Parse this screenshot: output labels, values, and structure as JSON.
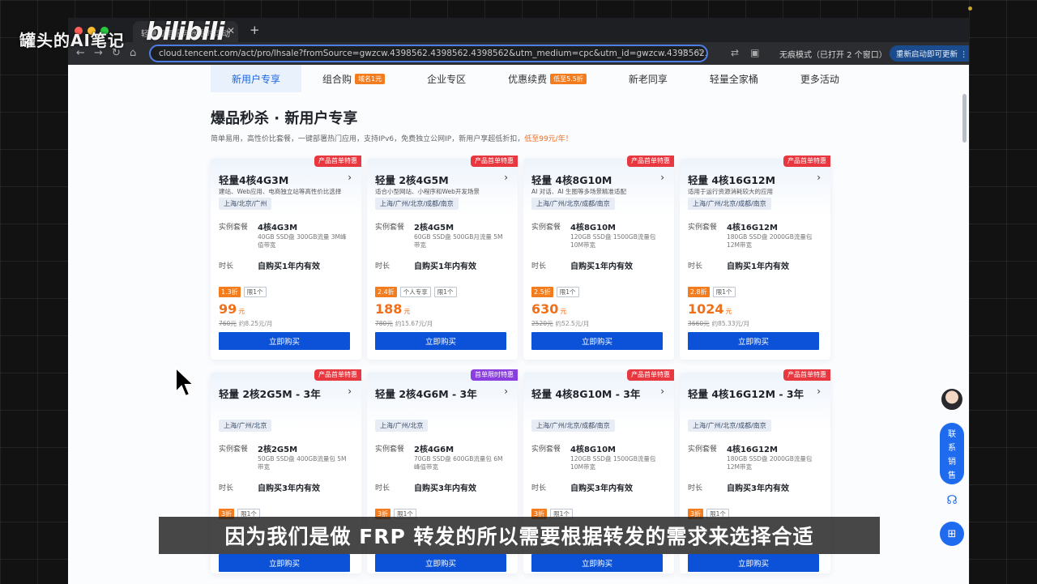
{
  "watermark": {
    "text": "罐头的AI笔记",
    "logo": "bilibili"
  },
  "browser": {
    "tab_title": "轻量应用服务器限时活动",
    "url": "cloud.tencent.com/act/pro/lhsale?fromSource=gwzcw.4398562.4398562.4398562&utm_medium=cpc&utm_id=gwzcw.4398562.4398562.439856",
    "incognito_label": "无痕模式（已打开 2 个窗口）",
    "update_label": "重新启动即可更新 ⋮"
  },
  "nav": {
    "items": [
      {
        "label": "新用户专享",
        "badge": ""
      },
      {
        "label": "组合购",
        "badge": "域名1元"
      },
      {
        "label": "企业专区",
        "badge": ""
      },
      {
        "label": "优惠续费",
        "badge": "低至5.5折"
      },
      {
        "label": "新老同享",
        "badge": ""
      },
      {
        "label": "轻量全家桶",
        "badge": ""
      },
      {
        "label": "更多活动",
        "badge": ""
      }
    ]
  },
  "hero": {
    "title": "爆品秒杀 · 新用户专享",
    "subtitle": "简单易用，高性价比套餐，一键部署热门应用，支持IPv6，免费独立公网IP，新用户享超低折扣，",
    "highlight": "低至99元/年！"
  },
  "labels": {
    "spec": "实例套餐",
    "duration": "时长",
    "buy": "立即购买"
  },
  "cards": [
    {
      "ribbon": "产品首单特惠",
      "title": "轻量4核4G3M",
      "desc": "建站、Web应用、电商独立站等高性价比选择",
      "region": "上海/北京/广州",
      "spec": "4核4G3M",
      "spec_desc": "40GB SSD盘 300GB流量 3M峰值带宽",
      "duration": "自购买1年内有效",
      "discount": "1.3折",
      "tags": [
        "限1个"
      ],
      "price": "99",
      "unit": "元",
      "orig_price": "760元",
      "monthly": "约8.25元/月"
    },
    {
      "ribbon": "产品首单特惠",
      "title": "轻量 2核4G5M",
      "desc": "适合小型网站、小程序和Web开发场景",
      "region": "上海/广州/北京/成都/南京",
      "spec": "2核4G5M",
      "spec_desc": "60GB SSD盘 500GB月流量 5M带宽",
      "duration": "自购买1年内有效",
      "discount": "2.4折",
      "tags": [
        "个人专享",
        "限1个"
      ],
      "price": "188",
      "unit": "元",
      "orig_price": "780元",
      "monthly": "约15.67元/月"
    },
    {
      "ribbon": "产品首单特惠",
      "title": "轻量 4核8G10M",
      "desc": "AI 对话、AI 生图等多场景精准适配",
      "region": "上海/广州/北京/成都/南京",
      "spec": "4核8G10M",
      "spec_desc": "120GB SSD盘 1500GB流量包 10M带宽",
      "duration": "自购买1年内有效",
      "discount": "2.5折",
      "tags": [
        "限1个"
      ],
      "price": "630",
      "unit": "元",
      "orig_price": "2520元",
      "monthly": "约52.5元/月"
    },
    {
      "ribbon": "产品首单特惠",
      "title": "轻量 4核16G12M",
      "desc": "适用于运行资源消耗较大的应用",
      "region": "上海/广州/北京/成都/南京",
      "spec": "4核16G12M",
      "spec_desc": "180GB SSD盘 2000GB流量包 12M带宽",
      "duration": "自购买1年内有效",
      "discount": "2.8折",
      "tags": [
        "限1个"
      ],
      "price": "1024",
      "unit": "元",
      "orig_price": "3660元",
      "monthly": "约85.33元/月"
    },
    {
      "ribbon": "产品首单特惠",
      "title": "轻量 2核2G5M - 3年",
      "desc": "",
      "region": "上海/广州/北京",
      "spec": "2核2G5M",
      "spec_desc": "50GB SSD盘 400GB流量包 5M带宽",
      "duration": "自购买3年内有效",
      "discount": "3折",
      "tags": [
        "限1个"
      ],
      "price": "",
      "unit": "",
      "orig_price": "",
      "monthly": ""
    },
    {
      "ribbon": "首单限时特惠",
      "title": "轻量 2核4G6M - 3年",
      "desc": "",
      "region": "上海/广州/北京",
      "spec": "2核4G6M",
      "spec_desc": "70GB SSD盘 600GB流量包 6M峰值带宽",
      "duration": "自购买3年内有效",
      "discount": "3折",
      "tags": [
        "限1个"
      ],
      "price": "",
      "unit": "",
      "orig_price": "",
      "monthly": ""
    },
    {
      "ribbon": "产品首单特惠",
      "title": "轻量 4核8G10M - 3年",
      "desc": "",
      "region": "上海/广州/北京/成都/南京",
      "spec": "4核8G10M",
      "spec_desc": "120GB SSD盘 1500GB流量包 10M带宽",
      "duration": "自购买3年内有效",
      "discount": "3折",
      "tags": [
        "限1个"
      ],
      "price": "",
      "unit": "",
      "orig_price": "",
      "monthly": ""
    },
    {
      "ribbon": "产品首单特惠",
      "title": "轻量 4核16G12M - 3年",
      "desc": "",
      "region": "上海/广州/北京/成都/南京",
      "spec": "4核16G12M",
      "spec_desc": "180GB SSD盘 2000GB流量包 12M带宽",
      "duration": "自购买3年内有效",
      "discount": "3折",
      "tags": [
        "限1个"
      ],
      "price": "",
      "unit": "",
      "orig_price": "",
      "monthly": ""
    }
  ],
  "side": {
    "contact_label": [
      "联",
      "系",
      "销",
      "售"
    ]
  },
  "subtitle": "因为我们是做 FRP 转发的所以需要根据转发的需求来选择合适",
  "colors": {
    "accent": "#0b52d9",
    "price": "#f07019",
    "ribbon_red": "#e8373f",
    "ribbon_purple": "#8a3ee0",
    "badge_orange": "#f27c1e"
  }
}
